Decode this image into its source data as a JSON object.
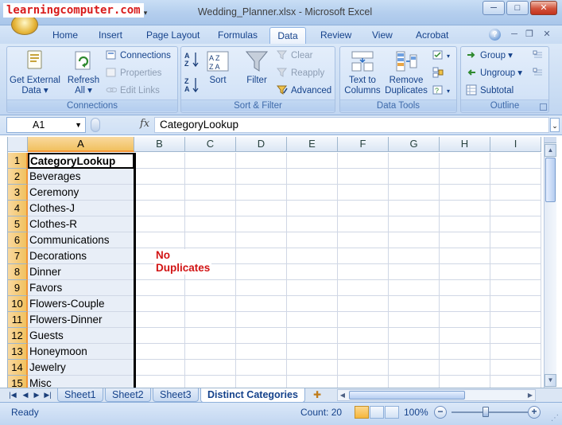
{
  "watermark": "learningcomputer.com",
  "window": {
    "title": "Wedding_Planner.xlsx - Microsoft Excel",
    "minimize": "─",
    "maximize": "□",
    "close": "✕"
  },
  "tabs": [
    "Home",
    "Insert",
    "Page Layout",
    "Formulas",
    "Data",
    "Review",
    "View",
    "Acrobat"
  ],
  "active_tab": "Data",
  "ribbon": {
    "connections": {
      "label": "Connections",
      "get_external_data": [
        "Get External",
        "Data ▾"
      ],
      "refresh_all": [
        "Refresh",
        "All ▾"
      ],
      "connections": "Connections",
      "properties": "Properties",
      "edit_links": "Edit Links"
    },
    "sort_filter": {
      "label": "Sort & Filter",
      "sort": "Sort",
      "filter": "Filter",
      "clear": "Clear",
      "reapply": "Reapply",
      "advanced": "Advanced"
    },
    "data_tools": {
      "label": "Data Tools",
      "text_to_columns": [
        "Text to",
        "Columns"
      ],
      "remove_duplicates": [
        "Remove",
        "Duplicates"
      ]
    },
    "outline": {
      "label": "Outline",
      "group": "Group ▾",
      "ungroup": "Ungroup ▾",
      "subtotal": "Subtotal"
    }
  },
  "formula_bar": {
    "name_box": "A1",
    "fx": "fx",
    "content": "CategoryLookup"
  },
  "columns": [
    "A",
    "B",
    "C",
    "D",
    "E",
    "F",
    "G",
    "H",
    "I"
  ],
  "rows": [
    "1",
    "2",
    "3",
    "4",
    "5",
    "6",
    "7",
    "8",
    "9",
    "10",
    "11",
    "12",
    "13",
    "14",
    "15"
  ],
  "column_a": [
    "CategoryLookup",
    "Beverages",
    "Ceremony",
    "Clothes-J",
    "Clothes-R",
    "Communications",
    "Decorations",
    "Dinner",
    "Favors",
    "Flowers-Couple",
    "Flowers-Dinner",
    "Guests",
    "Honeymoon",
    "Jewelry",
    "Misc"
  ],
  "annotation": [
    "No",
    "Duplicates"
  ],
  "sheets": [
    "Sheet1",
    "Sheet2",
    "Sheet3",
    "Distinct Categories"
  ],
  "active_sheet": "Distinct Categories",
  "status": {
    "mode": "Ready",
    "count": "Count: 20",
    "zoom": "100%"
  },
  "colors": {
    "accent": "#15428b",
    "selection": "#f1c15f",
    "annotation": "#d21414",
    "watermark": "#d81b1b"
  }
}
